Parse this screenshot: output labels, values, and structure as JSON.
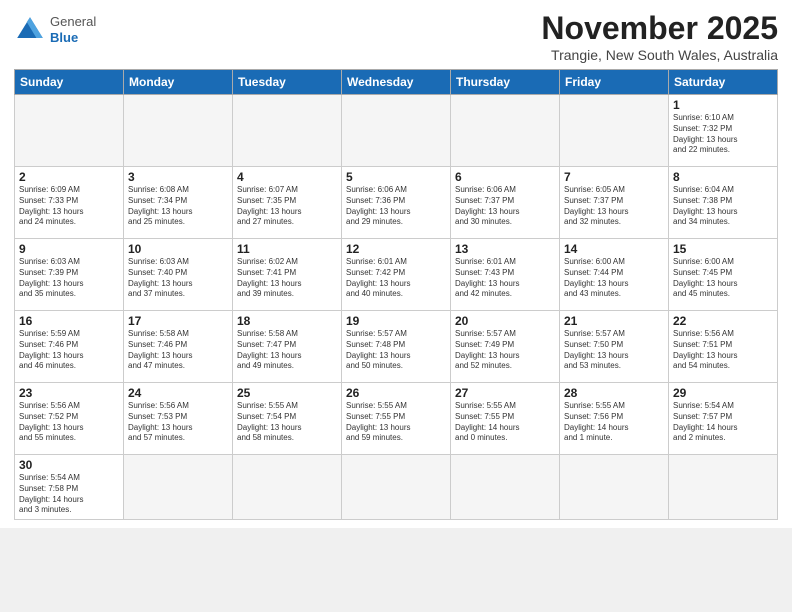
{
  "header": {
    "logo_general": "General",
    "logo_blue": "Blue",
    "month_title": "November 2025",
    "location": "Trangie, New South Wales, Australia"
  },
  "weekdays": [
    "Sunday",
    "Monday",
    "Tuesday",
    "Wednesday",
    "Thursday",
    "Friday",
    "Saturday"
  ],
  "weeks": [
    [
      {
        "day": "",
        "info": ""
      },
      {
        "day": "",
        "info": ""
      },
      {
        "day": "",
        "info": ""
      },
      {
        "day": "",
        "info": ""
      },
      {
        "day": "",
        "info": ""
      },
      {
        "day": "",
        "info": ""
      },
      {
        "day": "1",
        "info": "Sunrise: 6:10 AM\nSunset: 7:32 PM\nDaylight: 13 hours\nand 22 minutes."
      }
    ],
    [
      {
        "day": "2",
        "info": "Sunrise: 6:09 AM\nSunset: 7:33 PM\nDaylight: 13 hours\nand 24 minutes."
      },
      {
        "day": "3",
        "info": "Sunrise: 6:08 AM\nSunset: 7:34 PM\nDaylight: 13 hours\nand 25 minutes."
      },
      {
        "day": "4",
        "info": "Sunrise: 6:07 AM\nSunset: 7:35 PM\nDaylight: 13 hours\nand 27 minutes."
      },
      {
        "day": "5",
        "info": "Sunrise: 6:06 AM\nSunset: 7:36 PM\nDaylight: 13 hours\nand 29 minutes."
      },
      {
        "day": "6",
        "info": "Sunrise: 6:06 AM\nSunset: 7:37 PM\nDaylight: 13 hours\nand 30 minutes."
      },
      {
        "day": "7",
        "info": "Sunrise: 6:05 AM\nSunset: 7:37 PM\nDaylight: 13 hours\nand 32 minutes."
      },
      {
        "day": "8",
        "info": "Sunrise: 6:04 AM\nSunset: 7:38 PM\nDaylight: 13 hours\nand 34 minutes."
      }
    ],
    [
      {
        "day": "9",
        "info": "Sunrise: 6:03 AM\nSunset: 7:39 PM\nDaylight: 13 hours\nand 35 minutes."
      },
      {
        "day": "10",
        "info": "Sunrise: 6:03 AM\nSunset: 7:40 PM\nDaylight: 13 hours\nand 37 minutes."
      },
      {
        "day": "11",
        "info": "Sunrise: 6:02 AM\nSunset: 7:41 PM\nDaylight: 13 hours\nand 39 minutes."
      },
      {
        "day": "12",
        "info": "Sunrise: 6:01 AM\nSunset: 7:42 PM\nDaylight: 13 hours\nand 40 minutes."
      },
      {
        "day": "13",
        "info": "Sunrise: 6:01 AM\nSunset: 7:43 PM\nDaylight: 13 hours\nand 42 minutes."
      },
      {
        "day": "14",
        "info": "Sunrise: 6:00 AM\nSunset: 7:44 PM\nDaylight: 13 hours\nand 43 minutes."
      },
      {
        "day": "15",
        "info": "Sunrise: 6:00 AM\nSunset: 7:45 PM\nDaylight: 13 hours\nand 45 minutes."
      }
    ],
    [
      {
        "day": "16",
        "info": "Sunrise: 5:59 AM\nSunset: 7:46 PM\nDaylight: 13 hours\nand 46 minutes."
      },
      {
        "day": "17",
        "info": "Sunrise: 5:58 AM\nSunset: 7:46 PM\nDaylight: 13 hours\nand 47 minutes."
      },
      {
        "day": "18",
        "info": "Sunrise: 5:58 AM\nSunset: 7:47 PM\nDaylight: 13 hours\nand 49 minutes."
      },
      {
        "day": "19",
        "info": "Sunrise: 5:57 AM\nSunset: 7:48 PM\nDaylight: 13 hours\nand 50 minutes."
      },
      {
        "day": "20",
        "info": "Sunrise: 5:57 AM\nSunset: 7:49 PM\nDaylight: 13 hours\nand 52 minutes."
      },
      {
        "day": "21",
        "info": "Sunrise: 5:57 AM\nSunset: 7:50 PM\nDaylight: 13 hours\nand 53 minutes."
      },
      {
        "day": "22",
        "info": "Sunrise: 5:56 AM\nSunset: 7:51 PM\nDaylight: 13 hours\nand 54 minutes."
      }
    ],
    [
      {
        "day": "23",
        "info": "Sunrise: 5:56 AM\nSunset: 7:52 PM\nDaylight: 13 hours\nand 55 minutes."
      },
      {
        "day": "24",
        "info": "Sunrise: 5:56 AM\nSunset: 7:53 PM\nDaylight: 13 hours\nand 57 minutes."
      },
      {
        "day": "25",
        "info": "Sunrise: 5:55 AM\nSunset: 7:54 PM\nDaylight: 13 hours\nand 58 minutes."
      },
      {
        "day": "26",
        "info": "Sunrise: 5:55 AM\nSunset: 7:55 PM\nDaylight: 13 hours\nand 59 minutes."
      },
      {
        "day": "27",
        "info": "Sunrise: 5:55 AM\nSunset: 7:55 PM\nDaylight: 14 hours\nand 0 minutes."
      },
      {
        "day": "28",
        "info": "Sunrise: 5:55 AM\nSunset: 7:56 PM\nDaylight: 14 hours\nand 1 minute."
      },
      {
        "day": "29",
        "info": "Sunrise: 5:54 AM\nSunset: 7:57 PM\nDaylight: 14 hours\nand 2 minutes."
      }
    ],
    [
      {
        "day": "30",
        "info": "Sunrise: 5:54 AM\nSunset: 7:58 PM\nDaylight: 14 hours\nand 3 minutes."
      },
      {
        "day": "",
        "info": ""
      },
      {
        "day": "",
        "info": ""
      },
      {
        "day": "",
        "info": ""
      },
      {
        "day": "",
        "info": ""
      },
      {
        "day": "",
        "info": ""
      },
      {
        "day": "",
        "info": ""
      }
    ]
  ]
}
